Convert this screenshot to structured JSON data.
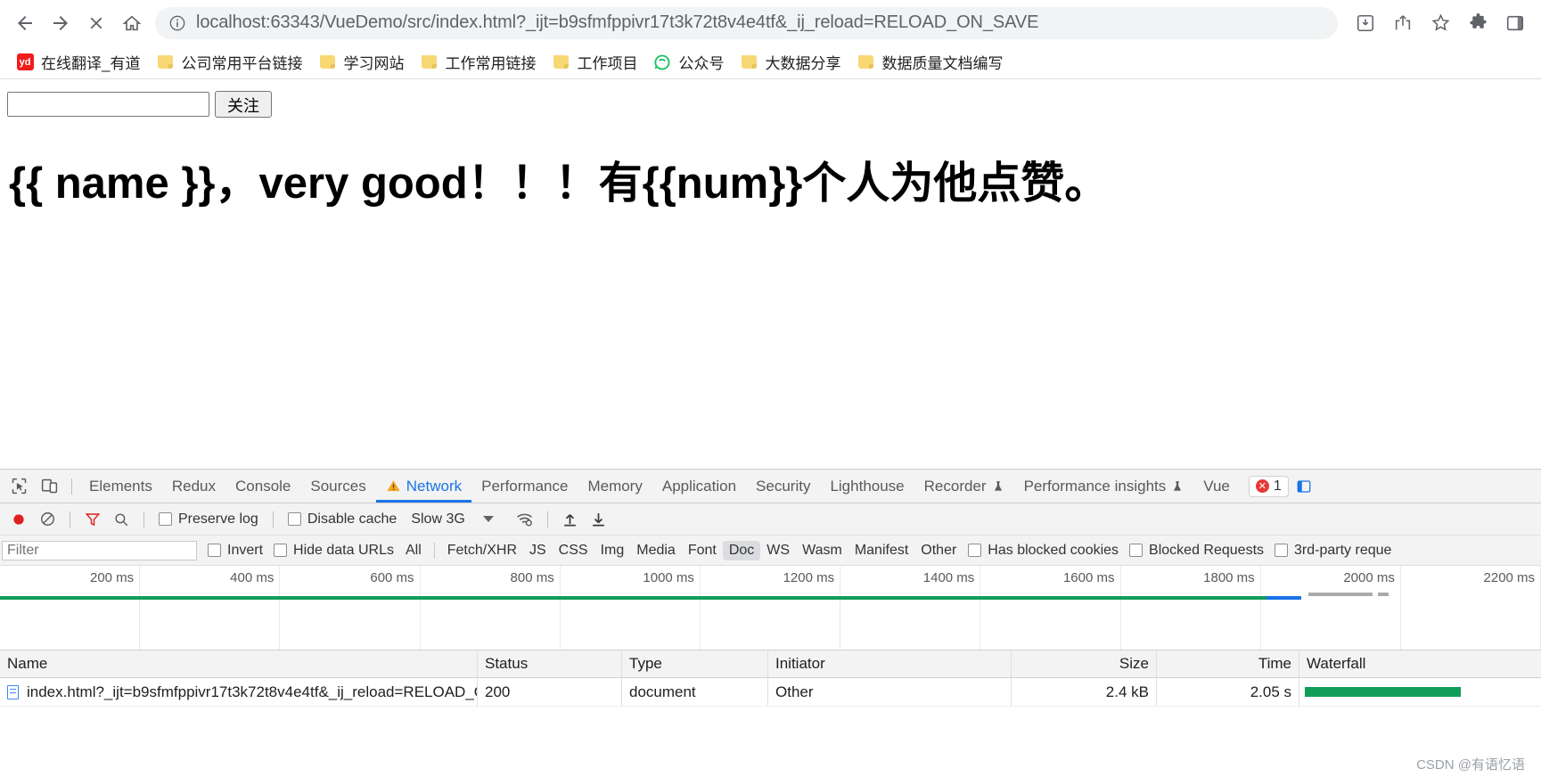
{
  "browser": {
    "nav": {
      "back_label": "Back",
      "forward_label": "Forward",
      "stop_label": "Stop",
      "home_label": "Home"
    },
    "omnibox": {
      "host": "localhost:63343",
      "path": "/VueDemo/src/index.html?_ijt=b9sfmfppivr17t3k72t8v4e4tf&_ij_reload=RELOAD_ON_SAVE",
      "full_url": "localhost:63343/VueDemo/src/index.html?_ijt=b9sfmfppivr17t3k72t8v4e4tf&_ij_reload=RELOAD_ON_SAVE",
      "info_icon": "info-circle-icon"
    },
    "toolbar_right": [
      {
        "icon": "install-app-icon",
        "label": "Install"
      },
      {
        "icon": "share-icon",
        "label": "Share"
      },
      {
        "icon": "star-icon",
        "label": "Bookmark"
      },
      {
        "icon": "puzzle-extensions-icon",
        "label": "Extensions"
      },
      {
        "icon": "side-panel-icon",
        "label": "Side panel"
      }
    ],
    "bookmarks": [
      {
        "label": "在线翻译_有道",
        "icon": "yd-favicon",
        "icon_text": "yd"
      },
      {
        "label": "公司常用平台链接",
        "icon": "folder-icon"
      },
      {
        "label": "学习网站",
        "icon": "folder-icon"
      },
      {
        "label": "工作常用链接",
        "icon": "folder-icon"
      },
      {
        "label": "工作项目",
        "icon": "folder-icon"
      },
      {
        "label": "公众号",
        "icon": "wechat-icon"
      },
      {
        "label": "大数据分享",
        "icon": "folder-icon"
      },
      {
        "label": "数据质量文档编写",
        "icon": "folder-icon"
      }
    ]
  },
  "page": {
    "name_input_value": "",
    "name_input_placeholder": "",
    "follow_button": "关注",
    "headline": "{{ name }}，very good！！！有{{num}}个人为他点赞。"
  },
  "devtools": {
    "left_icons": [
      {
        "name": "inspect-element-icon"
      },
      {
        "name": "device-toolbar-icon"
      }
    ],
    "tabs": [
      {
        "label": "Elements",
        "active": false,
        "warn": false
      },
      {
        "label": "Redux",
        "active": false,
        "warn": false
      },
      {
        "label": "Console",
        "active": false,
        "warn": false
      },
      {
        "label": "Sources",
        "active": false,
        "warn": false
      },
      {
        "label": "Network",
        "active": true,
        "warn": true
      },
      {
        "label": "Performance",
        "active": false,
        "warn": false
      },
      {
        "label": "Memory",
        "active": false,
        "warn": false
      },
      {
        "label": "Application",
        "active": false,
        "warn": false
      },
      {
        "label": "Security",
        "active": false,
        "warn": false
      },
      {
        "label": "Lighthouse",
        "active": false,
        "warn": false
      },
      {
        "label": "Recorder",
        "active": false,
        "warn": false,
        "beaker": true
      },
      {
        "label": "Performance insights",
        "active": false,
        "warn": false,
        "beaker": true
      },
      {
        "label": "Vue",
        "active": false,
        "warn": false
      }
    ],
    "error_badge": {
      "count": "1",
      "icon": "error-circle-icon"
    },
    "network_toolbar": {
      "record_label": "Record",
      "clear_label": "Clear",
      "filter_icon": "funnel-filter-icon",
      "search_icon": "search-icon",
      "preserve_log": {
        "label": "Preserve log",
        "checked": false
      },
      "disable_cache": {
        "label": "Disable cache",
        "checked": false
      },
      "throttle": "Slow 3G",
      "network_conditions_icon": "wifi-settings-icon",
      "import_icon": "import-har-icon",
      "export_icon": "export-har-icon"
    },
    "filter_bar": {
      "filter_placeholder": "Filter",
      "filter_value": "",
      "invert": {
        "label": "Invert",
        "checked": false
      },
      "hide_data_urls": {
        "label": "Hide data URLs",
        "checked": false
      },
      "types": [
        {
          "label": "All",
          "selected": false
        },
        {
          "label": "Fetch/XHR",
          "selected": false
        },
        {
          "label": "JS",
          "selected": false
        },
        {
          "label": "CSS",
          "selected": false
        },
        {
          "label": "Img",
          "selected": false
        },
        {
          "label": "Media",
          "selected": false
        },
        {
          "label": "Font",
          "selected": false
        },
        {
          "label": "Doc",
          "selected": true
        },
        {
          "label": "WS",
          "selected": false
        },
        {
          "label": "Wasm",
          "selected": false
        },
        {
          "label": "Manifest",
          "selected": false
        },
        {
          "label": "Other",
          "selected": false
        }
      ],
      "has_blocked_cookies": {
        "label": "Has blocked cookies",
        "checked": false
      },
      "blocked_requests": {
        "label": "Blocked Requests",
        "checked": false
      },
      "third_party_requests": {
        "label": "3rd-party reque",
        "checked": false
      }
    },
    "overview": {
      "ticks": [
        "200 ms",
        "400 ms",
        "600 ms",
        "800 ms",
        "1000 ms",
        "1200 ms",
        "1400 ms",
        "1600 ms",
        "1800 ms",
        "2000 ms",
        "2200 ms"
      ],
      "bar_color": "#0f9d58",
      "accent_color": "#1a73e8"
    },
    "table": {
      "columns": [
        "Name",
        "Status",
        "Type",
        "Initiator",
        "Size",
        "Time",
        "Waterfall"
      ],
      "rows": [
        {
          "name": "index.html?_ijt=b9sfmfppivr17t3k72t8v4e4tf&_ij_reload=RELOAD_O...",
          "status": "200",
          "type": "document",
          "initiator": "Other",
          "size": "2.4 kB",
          "time": "2.05 s",
          "icon": "document-file-icon"
        }
      ]
    }
  },
  "watermark": "CSDN @有语忆语"
}
